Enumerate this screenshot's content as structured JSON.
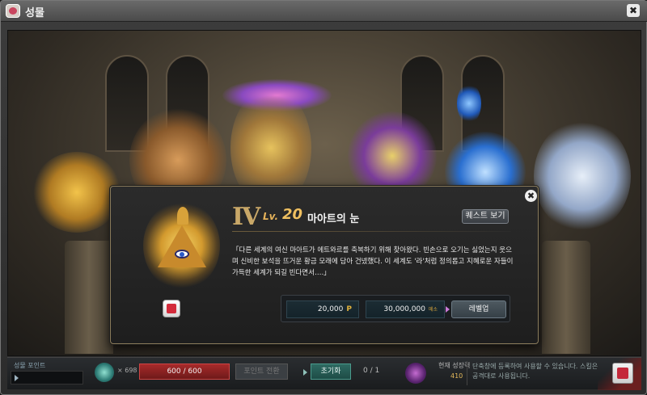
{
  "window": {
    "title": "성물",
    "close_label": "✖"
  },
  "scene": {
    "relics": [
      "golden-pyramid",
      "bronze-idol",
      "golden-bracelet",
      "purple-dial",
      "blue-orb",
      "cloud-dragon"
    ]
  },
  "modal": {
    "roman_level": "IV",
    "lv_label": "Lv.",
    "lv_value": "20",
    "relic_name": "마아트의 눈",
    "quest_button": "퀘스트 보기",
    "description": "「다른 세계의 여신 마아트가 에트와르를 축복하기 위해 찾아왔다. 빈손으로 오기는 싫었는지 웃으며 신비한 보석을 뜨거운 황금 모래에 담아 건넸했다. 이 세계도 '라'처럼 정의롭고 지혜로운 자들이 가득한 세계가 되길 빈다면서….」",
    "close_label": "✖",
    "cost_points": "20,000",
    "cost_points_unit": "P",
    "cost_meso": "30,000,000",
    "cost_meso_unit": "메소",
    "levelup_button": "레벨업"
  },
  "bottom": {
    "points_label": "성물 포인트",
    "orb_count": "× 698",
    "hp_value": "600 / 600",
    "exchange_button": "포인트 전환",
    "reset_button": "초기화",
    "reset_count": "0 / 1",
    "growth_label": "현재 성장력",
    "growth_value": "410",
    "info_text": "단축창에 등록하여 사용할 수 있습니다. 스킬은 공격대로 사용됩니다."
  },
  "colors": {
    "accent_gold": "#e6b35a",
    "hp_red": "#a72a2a",
    "reset_teal": "#2e6a62"
  }
}
